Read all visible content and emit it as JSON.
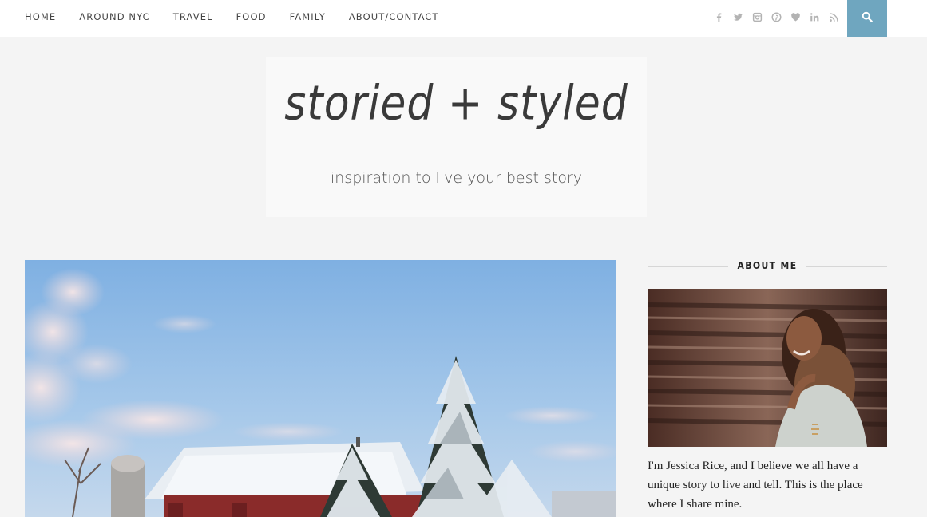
{
  "nav": {
    "items": [
      {
        "label": "HOME"
      },
      {
        "label": "AROUND NYC"
      },
      {
        "label": "TRAVEL"
      },
      {
        "label": "FOOD"
      },
      {
        "label": "FAMILY"
      },
      {
        "label": "ABOUT/CONTACT"
      }
    ],
    "social_icons": [
      "facebook-icon",
      "twitter-icon",
      "instagram-icon",
      "pinterest-icon",
      "bloglovin-heart-icon",
      "linkedin-icon",
      "rss-icon"
    ],
    "search_icon": "search-icon",
    "accent_color": "#6fa6bf"
  },
  "header": {
    "title": "storied + styled",
    "tagline": "inspiration to live your best story"
  },
  "sidebar": {
    "widget_title": "ABOUT ME",
    "about_text": "I'm Jessica Rice, and I believe we all have a unique story to live and tell. This is the place where I share mine."
  }
}
